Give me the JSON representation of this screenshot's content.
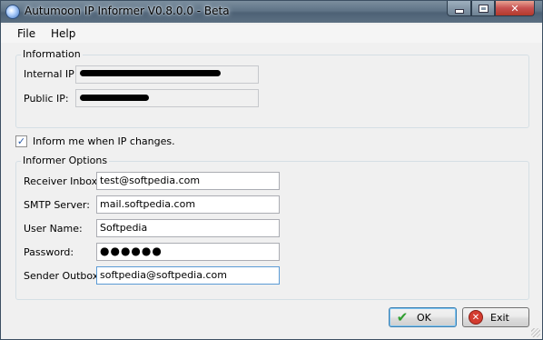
{
  "window": {
    "title": "Autumoon IP Informer V0.8.0.0 - Beta"
  },
  "menu": [
    "File",
    "Help"
  ],
  "information": {
    "group_label": "Information",
    "internal_ip_label": "Internal IP:",
    "public_ip_label": "Public IP:"
  },
  "inform_checkbox": {
    "label": "Inform me when IP changes.",
    "checked": true
  },
  "informer_options": {
    "group_label": "Informer Options",
    "receiver_inbox_label": "Receiver Inbox:",
    "receiver_inbox_value": "test@softpedia.com",
    "smtp_server_label": "SMTP Server:",
    "smtp_server_value": "mail.softpedia.com",
    "user_name_label": "User Name:",
    "user_name_value": "Softpedia",
    "password_label": "Password:",
    "password_value": "●●●●●●",
    "sender_outbox_label": "Sender Outbox:",
    "sender_outbox_value": "softpedia@softpedia.com"
  },
  "buttons": {
    "ok_label": "OK",
    "exit_label": "Exit"
  },
  "icons": {
    "app": "globe-icon",
    "ok": "checkmark-icon",
    "exit": "close-circle-icon"
  },
  "colors": {
    "window_bg": "#f0f0f0",
    "titlebar": "#5f7386",
    "close_button": "#c75050",
    "checkmark": "#2a5ba8"
  }
}
